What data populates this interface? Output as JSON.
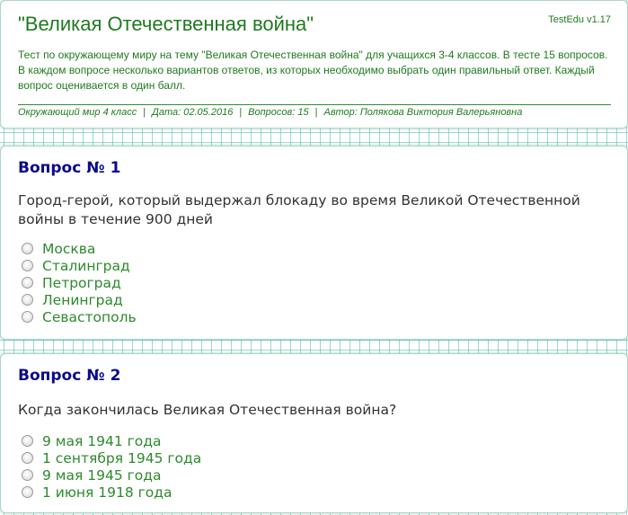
{
  "header": {
    "title": "\"Великая Отечественная война\"",
    "version": "TestEdu v1.17",
    "description": "Тест по окружающему миру на тему \"Великая Отечественная война\" для учащихся 3-4 классов. В тесте 15 вопросов. В каждом вопросе несколько вариантов ответов, из которых необходимо выбрать один правильный ответ. Каждый вопрос оценивается в один балл.",
    "meta": {
      "subject": "Окружающий мир 4 класс",
      "date": "Дата: 02.05.2016",
      "questions": "Вопросов: 15",
      "author": "Автор: Полякова Виктория Валерьяновна",
      "separator": "|"
    }
  },
  "questions": [
    {
      "title": "Вопрос № 1",
      "text": "Город-герой, который выдержал блокаду во время Великой Отечественной войны в течение 900 дней",
      "answers": [
        "Москва",
        "Сталинград",
        "Петроград",
        "Ленинград",
        "Севастополь"
      ]
    },
    {
      "title": "Вопрос № 2",
      "text": "Когда закончилась Великая Отечественная война?",
      "answers": [
        "9 мая 1941 года",
        "1 сентября 1945 года",
        "9 мая 1945 года",
        "1 июня 1918 года"
      ]
    }
  ],
  "colors": {
    "title_green": "#1f7a1f",
    "question_title_navy": "#0b0b8a",
    "answer_green": "#2d8a2d",
    "grid_teal": "#46beaa"
  },
  "icons": {
    "radio": "radio-unchecked-icon"
  }
}
